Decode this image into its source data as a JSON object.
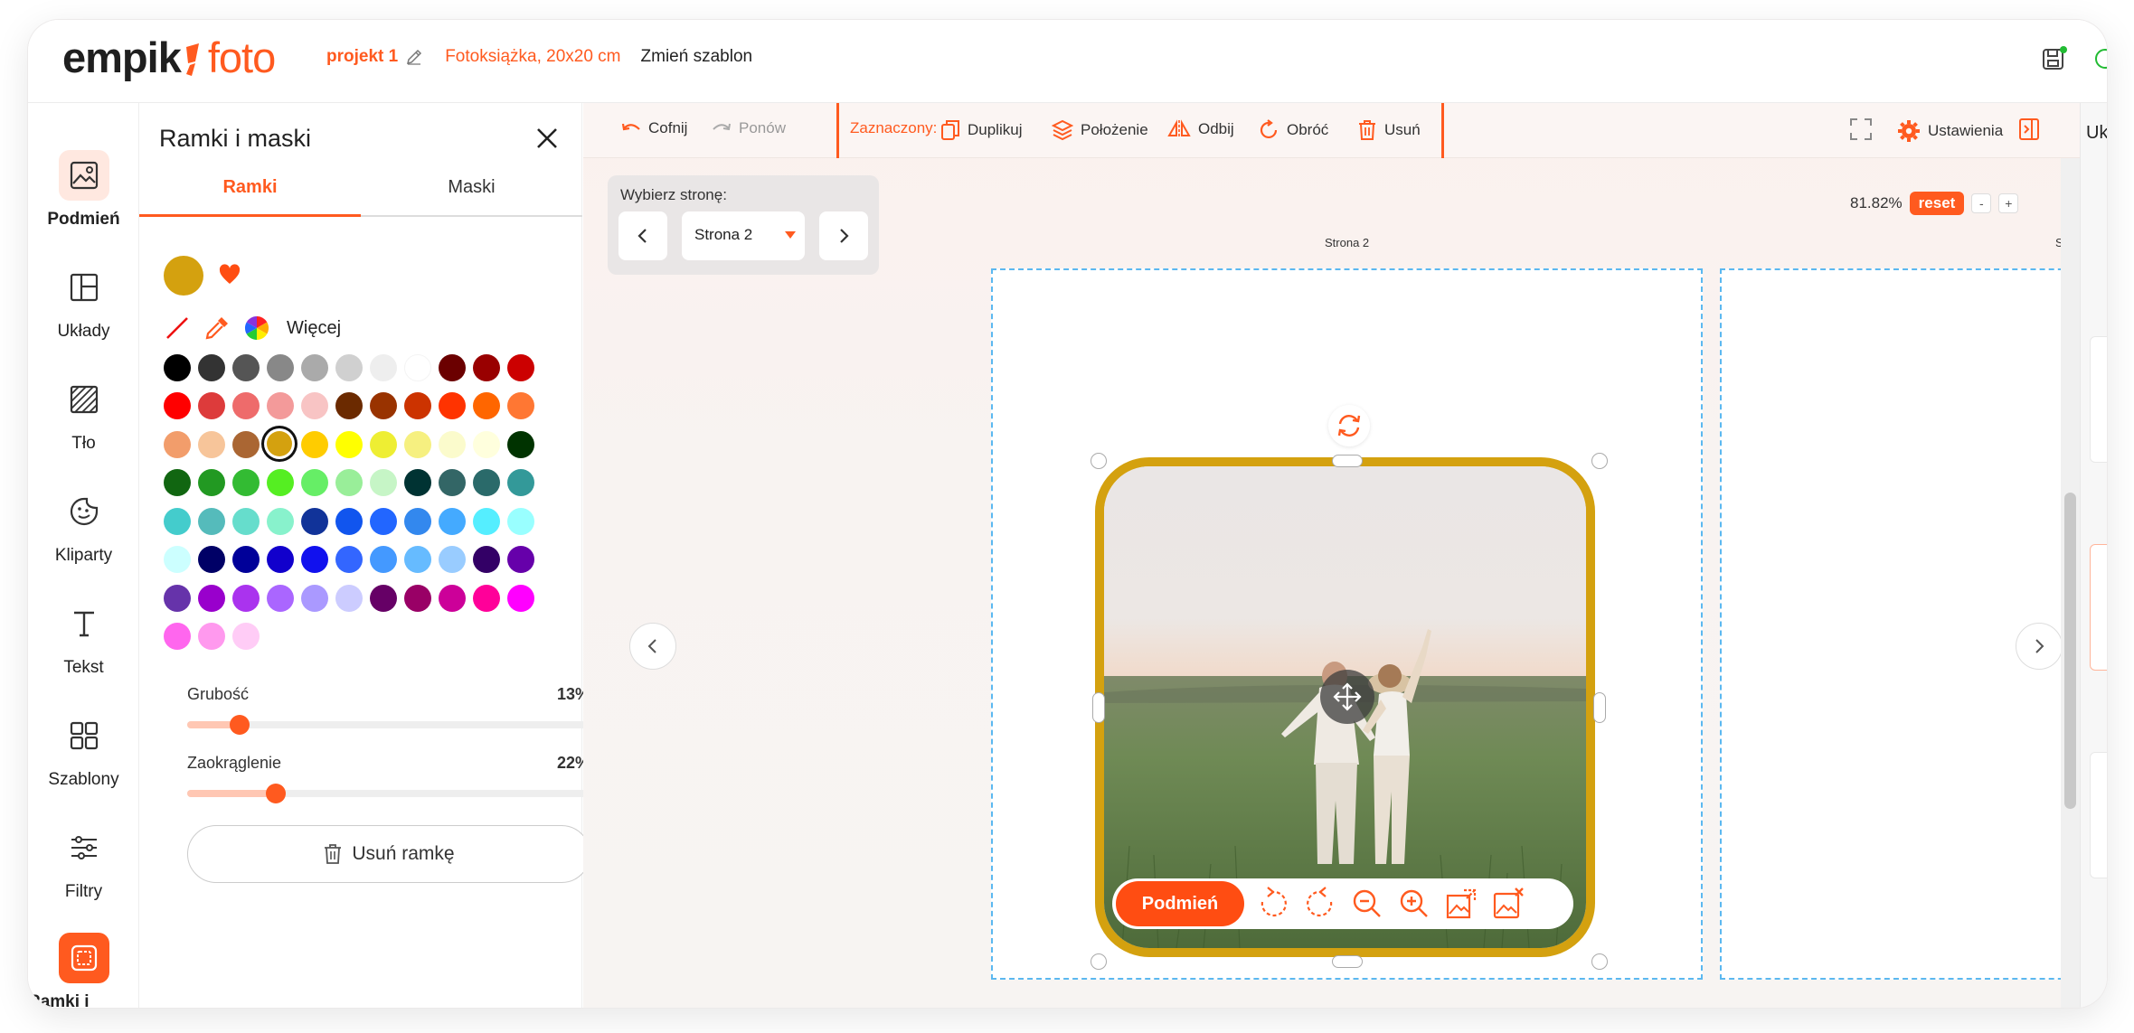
{
  "header": {
    "logo_main": "empik",
    "logo_foto": "foto",
    "project_name": "projekt 1",
    "product": "Fotoksiążka, 20x20 cm",
    "change_template": "Zmień szablon"
  },
  "rail": {
    "items": [
      {
        "label": "Podmień",
        "icon": "image-icon"
      },
      {
        "label": "Układy",
        "icon": "layout-icon"
      },
      {
        "label": "Tło",
        "icon": "background-icon"
      },
      {
        "label": "Kliparty",
        "icon": "sticker-icon"
      },
      {
        "label": "Tekst",
        "icon": "text-icon"
      },
      {
        "label": "Szablony",
        "icon": "templates-icon"
      },
      {
        "label": "Filtry",
        "icon": "filters-icon"
      },
      {
        "label": "Ramki i maski",
        "icon": "frame-icon"
      }
    ]
  },
  "panel": {
    "title": "Ramki i maski",
    "tabs": [
      "Ramki",
      "Maski"
    ],
    "more_label": "Więcej",
    "current_color": "#d4a10f",
    "palette": [
      [
        "#000000",
        "#333333",
        "#555555",
        "#888888",
        "#aaaaaa",
        "#d0d0d0",
        "#eeeeee",
        "#ffffff",
        "#6b0000",
        "#990000",
        "#cc0000"
      ],
      [
        "#ff0000",
        "#dd3b3b",
        "#ee6b6b",
        "#f39a9a",
        "#f8c4c4",
        "#6b2a00",
        "#993300",
        "#cc3300",
        "#ff3300",
        "#ff6600",
        "#ff7733"
      ],
      [
        "#f29d6b",
        "#f7c59a",
        "#aa6633",
        "#d4a10f",
        "#ffcc00",
        "#ffff00",
        "#eeee33",
        "#f6f080",
        "#fbfbcc",
        "#ffffdd",
        "#003300"
      ],
      [
        "#116611",
        "#229922",
        "#33bb33",
        "#55ee22",
        "#66ee66",
        "#99ee99",
        "#c6f5c6",
        "#003333",
        "#336666",
        "#2a6a6a",
        "#339999"
      ],
      [
        "#44cccc",
        "#55bbbb",
        "#66ddcc",
        "#88f2cc",
        "#113399",
        "#1155ee",
        "#2266ff",
        "#3388ee",
        "#44aaff",
        "#55eeff",
        "#99ffff"
      ],
      [
        "#ccffff",
        "#000066",
        "#000099",
        "#1100cc",
        "#1111ee",
        "#3366ff",
        "#4499ff",
        "#66bbff",
        "#99ccff",
        "#330066",
        "#6600aa"
      ],
      [
        "#6633aa",
        "#9900cc",
        "#aa33ee",
        "#aa66ff",
        "#aa99ff",
        "#ccccff",
        "#660066",
        "#990066",
        "#cc0099",
        "#ff0099",
        "#ff00ff"
      ],
      [
        "#ff66ee",
        "#ff99ee",
        "#ffccf6"
      ]
    ],
    "selected_swatch": "#d4a10f",
    "thickness": {
      "label": "Grubość",
      "value": "13%",
      "fraction": 0.13
    },
    "rounding": {
      "label": "Zaokrąglenie",
      "value": "22%",
      "fraction": 0.22
    },
    "remove_frame": "Usuń ramkę"
  },
  "toolbar": {
    "undo": "Cofnij",
    "redo": "Ponów",
    "selected_label": "Zaznaczony:",
    "duplicate": "Duplikuj",
    "position": "Położenie",
    "flip": "Odbij",
    "rotate": "Obróć",
    "delete": "Usuń",
    "settings": "Ustawienia"
  },
  "zoom": {
    "value": "81.82%",
    "reset": "reset",
    "minus": "-",
    "plus": "+"
  },
  "page_picker": {
    "label": "Wybierz stronę:",
    "selected": "Strona 2"
  },
  "pages": {
    "current_label": "Strona 2",
    "next_label": "Stroi"
  },
  "image_bar": {
    "replace": "Podmień"
  },
  "right_panel": {
    "label": "Układ"
  },
  "colors": {
    "accent": "#ff5a1f",
    "frame": "#d4a10f",
    "selection": "#5bb8f0"
  }
}
